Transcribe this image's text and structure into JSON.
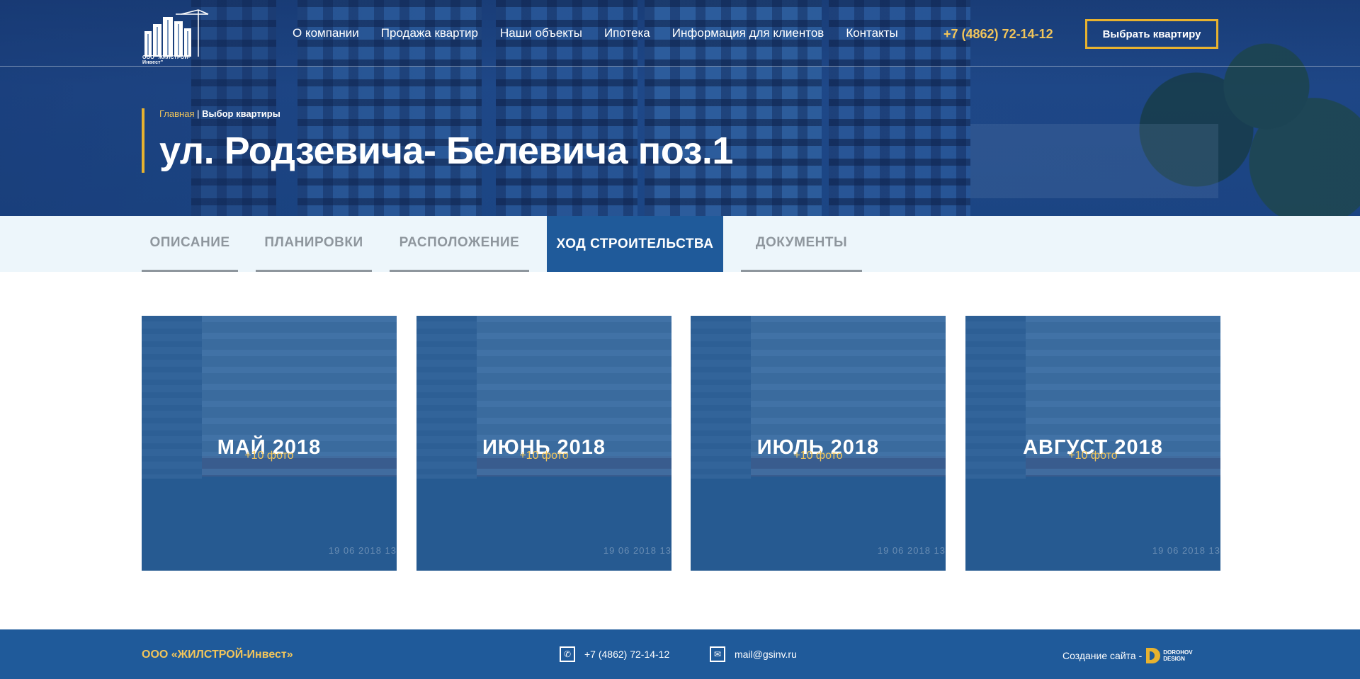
{
  "header": {
    "logo_text": "ООО \"ЖИЛСТРОЙ-Инвест\"",
    "nav": [
      "О компании",
      "Продажа квартир",
      "Наши объекты",
      "Ипотека",
      "Информация для клиентов",
      "Контакты"
    ],
    "phone": "+7 (4862) 72-14-12",
    "cta": "Выбрать квартиру"
  },
  "hero": {
    "breadcrumb": {
      "home": "Главная",
      "separator": " | ",
      "current": "Выбор квартиры"
    },
    "title": "ул. Родзевича- Белевича поз.1"
  },
  "tabs": [
    {
      "label": "ОПИСАНИЕ",
      "active": false
    },
    {
      "label": "ПЛАНИРОВКИ",
      "active": false
    },
    {
      "label": "РАСПОЛОЖЕНИЕ",
      "active": false
    },
    {
      "label": "ХОД СТРОИТЕЛЬСТВА",
      "active": true
    },
    {
      "label": "ДОКУМЕНТЫ",
      "active": false
    }
  ],
  "gallery": [
    {
      "title": "МАЙ 2018",
      "count": "+10 фото",
      "stamp": "19 06 2018 13"
    },
    {
      "title": "ИЮНЬ 2018",
      "count": "+10 фото",
      "stamp": "19 06 2018 13"
    },
    {
      "title": "ИЮЛЬ 2018",
      "count": "+10 фото",
      "stamp": "19 06 2018 13"
    },
    {
      "title": "АВГУСТ 2018",
      "count": "+10 фото",
      "stamp": "19 06 2018 13"
    }
  ],
  "footer": {
    "company": "ООО «ЖИЛСТРОЙ-Инвест»",
    "phone": "+7 (4862) 72-14-12",
    "email": "mail@gsinv.ru",
    "credit": "Создание сайта -",
    "studio_line1": "DOROHOV",
    "studio_line2": "DESIGN"
  },
  "colors": {
    "primary": "#1f5a9a",
    "accent": "#e7b22f",
    "phone": "#f2c55a",
    "tabs_bg": "#edf6fb",
    "tab_inactive": "#8e969d"
  }
}
